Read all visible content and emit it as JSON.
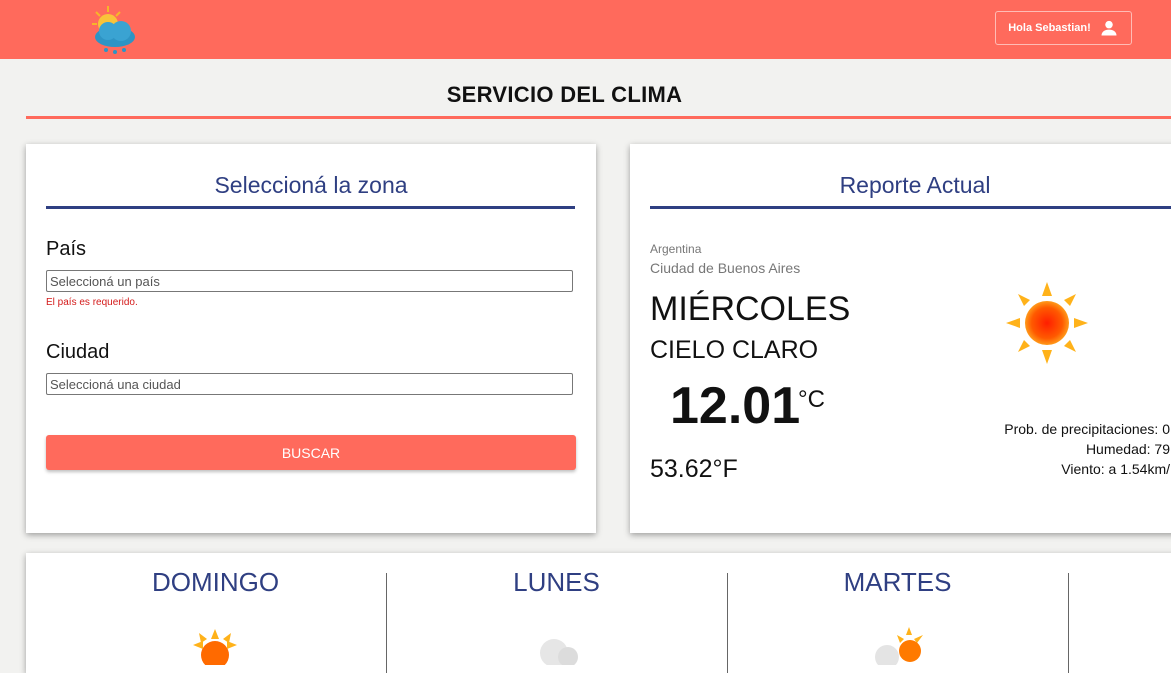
{
  "header": {
    "logo_icon": "sun-cloud-rain-icon",
    "user_greeting": "Hola Sebastian!",
    "user_icon": "person-icon",
    "bar_color": "#ff6a5c"
  },
  "page": {
    "title": "SERVICIO DEL CLIMA"
  },
  "zone_form": {
    "heading": "Seleccioná la zona",
    "country": {
      "label": "País",
      "placeholder": "Seleccioná un país",
      "value": "",
      "error": "El país es requerido."
    },
    "city": {
      "label": "Ciudad",
      "placeholder": "Seleccioná una ciudad",
      "value": ""
    },
    "search_button": "BUSCAR"
  },
  "report": {
    "heading": "Reporte Actual",
    "country": "Argentina",
    "city": "Ciudad de Buenos Aires",
    "day": "MIÉRCOLES",
    "condition": "CIELO CLARO",
    "temp_c": "12.01",
    "temp_c_unit": "°C",
    "temp_f": "53.62°F",
    "weather_icon": "sun-icon",
    "precipitation": "Prob. de precipitaciones: 0",
    "humidity": "Humedad: 79",
    "wind": "Viento: a 1.54km/"
  },
  "forecast": {
    "days": [
      {
        "name": "DOMINGO",
        "icon": "sun-icon"
      },
      {
        "name": "LUNES",
        "icon": "cloud-icon"
      },
      {
        "name": "MARTES",
        "icon": "cloud-sun-icon"
      }
    ]
  },
  "colors": {
    "accent": "#ff6a5c",
    "heading_blue": "#2f3f82",
    "error_red": "#d41a1a"
  }
}
